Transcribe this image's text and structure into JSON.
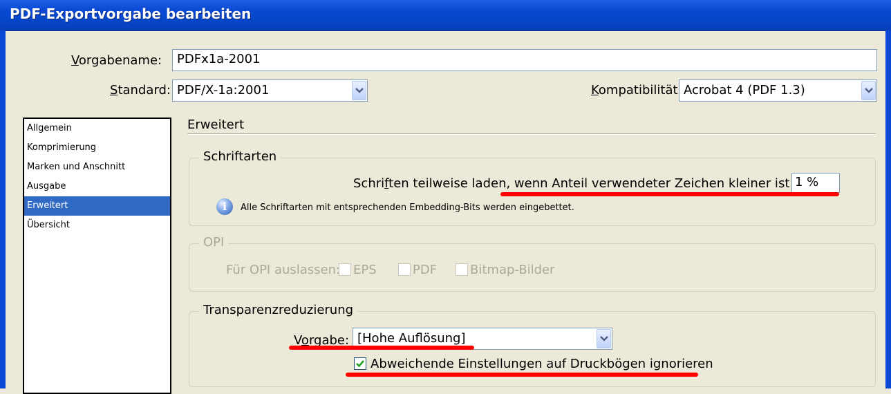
{
  "window": {
    "title": "PDF-Exportvorgabe bearbeiten"
  },
  "preset_name": {
    "label": "Vorgabename:",
    "value": "PDFx1a-2001"
  },
  "standard": {
    "label": "Standard:",
    "value": "PDF/X-1a:2001"
  },
  "compatibility": {
    "label": "Kompatibilität:",
    "value": "Acrobat 4 (PDF 1.3)"
  },
  "sidebar": {
    "items": [
      {
        "label": "Allgemein"
      },
      {
        "label": "Komprimierung"
      },
      {
        "label": "Marken und Anschnitt"
      },
      {
        "label": "Ausgabe"
      },
      {
        "label": "Erweitert",
        "selected": true
      },
      {
        "label": "Übersicht"
      }
    ]
  },
  "section": {
    "title": "Erweitert"
  },
  "fonts": {
    "legend": "Schriftarten",
    "subset_label": "Schriften teilweise laden, wenn Anteil verwendeter Zeichen kleiner ist als:",
    "subset_value": "1 %",
    "info_text": "Alle Schriftarten mit entsprechenden Embedding-Bits werden eingebettet.",
    "info_icon": "info-icon"
  },
  "opi": {
    "legend": "OPI",
    "omit_label": "Für OPI auslassen:",
    "options": [
      {
        "label": "EPS",
        "checked": false
      },
      {
        "label": "PDF",
        "checked": false
      },
      {
        "label": "Bitmap-Bilder",
        "checked": false
      }
    ]
  },
  "transparency": {
    "legend": "Transparenzreduzierung",
    "preset_label": "Vorgabe:",
    "preset_value": "[Hohe Auflösung]",
    "ignore_label": "Abweichende Einstellungen auf Druckbögen ignorieren",
    "ignore_checked": true
  },
  "colors": {
    "titlebar": "#0a48d4",
    "selection": "#316ac5",
    "annotation": "#ff0000"
  }
}
